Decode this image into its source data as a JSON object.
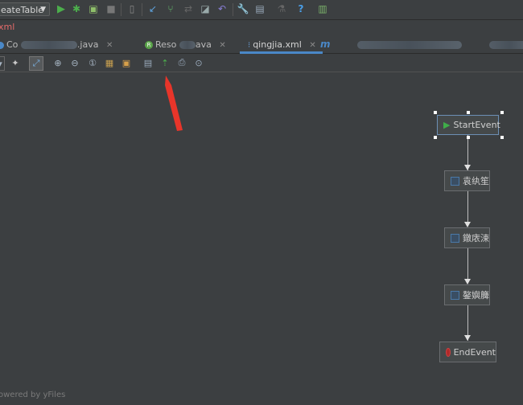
{
  "toolbar": {
    "run_config": "eateTable",
    "icons": [
      "run-icon",
      "debug-icon",
      "coverage-icon",
      "stop-icon",
      "attach-icon",
      "vcs-update-icon",
      "vcs-commit-icon",
      "vcs-compare-icon",
      "vcs-history-icon",
      "vcs-revert-icon",
      "settings-icon",
      "project-structure-icon",
      "sdk-icon",
      "help-icon",
      "tasks-icon"
    ]
  },
  "navbar": {
    "file_label": "xml"
  },
  "tabs": [
    {
      "label": "Co",
      "suffix": ".java"
    },
    {
      "label": "Reso",
      "suffix": "ava"
    },
    {
      "label": "qingjia.xml",
      "active": true
    },
    {
      "label": "m"
    }
  ],
  "diagram": {
    "nodes": [
      {
        "id": "start",
        "label": "StartEvent",
        "type": "start",
        "selected": true
      },
      {
        "id": "task1",
        "label": "袁纨笙",
        "type": "task"
      },
      {
        "id": "task2",
        "label": "鐓庡涑",
        "type": "task"
      },
      {
        "id": "task3",
        "label": "鏊嬩簲",
        "type": "task"
      },
      {
        "id": "end",
        "label": "EndEvent",
        "type": "end"
      }
    ]
  },
  "footer": {
    "text": "owered by yFiles"
  },
  "colors": {
    "start_icon": "#3fae49",
    "end_icon": "#b02a2a",
    "task_icon": "#4a79a8",
    "annotation_arrow": "#e8352a"
  }
}
